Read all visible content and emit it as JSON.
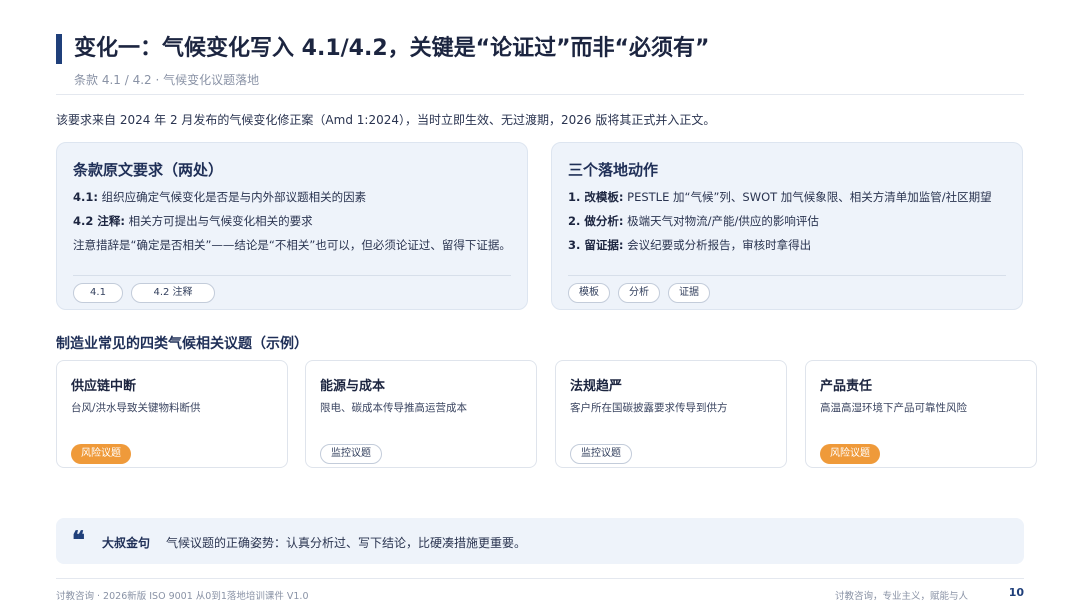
{
  "header": {
    "title": "变化一：气候变化写入 4.1/4.2，关键是“论证过”而非“必须有”",
    "subtitle": "条款 4.1 / 4.2 · 气候变化议题落地"
  },
  "intro": "该要求来自 2024 年 2 月发布的气候变化修正案（Amd 1:2024），当时立即生效、无过渡期，2026 版将其正式并入正文。",
  "left_card": {
    "title": "条款原文要求（两处）",
    "lines": [
      {
        "label": "4.1:",
        "text": " 组织应确定气候变化是否是与内外部议题相关的因素"
      },
      {
        "label": "4.2 注释:",
        "text": " 相关方可提出与气候变化相关的要求"
      },
      {
        "label": "",
        "text": "注意措辞是“确定是否相关”——结论是“不相关”也可以，但必须论证过、留得下证据。"
      }
    ],
    "chips": [
      "4.1",
      "4.2 注释"
    ]
  },
  "right_card": {
    "title": "三个落地动作",
    "lines": [
      {
        "label": "1. 改模板:",
        "text": " PESTLE 加“气候”列、SWOT 加气候象限、相关方清单加监管/社区期望"
      },
      {
        "label": "2. 做分析:",
        "text": " 极端天气对物流/产能/供应的影响评估"
      },
      {
        "label": "3. 留证据:",
        "text": " 会议纪要或分析报告，审核时拿得出"
      }
    ],
    "chips": [
      "模板",
      "分析",
      "证据"
    ]
  },
  "section_title": "制造业常见的四类气候相关议题（示例）",
  "topics": [
    {
      "title": "供应链中断",
      "desc": "台风/洪水导致关键物料断供",
      "tag": "风险议题",
      "tag_type": "risk"
    },
    {
      "title": "能源与成本",
      "desc": "限电、碳成本传导推高运营成本",
      "tag": "监控议题",
      "tag_type": "monitor"
    },
    {
      "title": "法规趋严",
      "desc": "客户所在国碳披露要求传导到供方",
      "tag": "监控议题",
      "tag_type": "monitor"
    },
    {
      "title": "产品责任",
      "desc": "高温高湿环境下产品可靠性风险",
      "tag": "风险议题",
      "tag_type": "risk"
    }
  ],
  "quote": {
    "icon": "quote-icon",
    "label": "大叔金句",
    "text": "气候议题的正确姿势：认真分析过、写下结论，比硬凑措施更重要。"
  },
  "footer": {
    "left": "讨教咨询 · 2026新版 ISO 9001 从0到1落地培训课件 V1.0",
    "right": "讨教咨询，专业主义，赋能与人",
    "page": "10"
  },
  "colors": {
    "accent": "#1f3f7a",
    "risk_tag": "#ef9a3a",
    "card_bg": "#eef3fa"
  }
}
